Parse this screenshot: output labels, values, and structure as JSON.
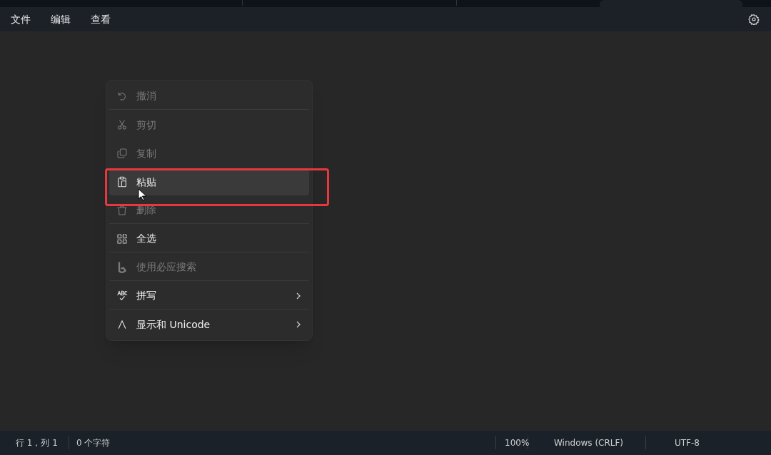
{
  "menu_bar": {
    "items": [
      "文件",
      "编辑",
      "查看"
    ]
  },
  "context_menu": {
    "items": [
      {
        "label": "撤消",
        "disabled": true,
        "hovered": false,
        "submenu": false,
        "separator_after": true
      },
      {
        "label": "剪切",
        "disabled": true,
        "hovered": false,
        "submenu": false,
        "separator_after": false
      },
      {
        "label": "复制",
        "disabled": true,
        "hovered": false,
        "submenu": false,
        "separator_after": false
      },
      {
        "label": "粘贴",
        "disabled": false,
        "hovered": true,
        "submenu": false,
        "separator_after": false
      },
      {
        "label": "删除",
        "disabled": true,
        "hovered": false,
        "submenu": false,
        "separator_after": true
      },
      {
        "label": "全选",
        "disabled": false,
        "hovered": false,
        "submenu": false,
        "separator_after": true
      },
      {
        "label": "使用必应搜索",
        "disabled": true,
        "hovered": false,
        "submenu": false,
        "separator_after": true
      },
      {
        "label": "拼写",
        "disabled": false,
        "hovered": false,
        "submenu": true,
        "separator_after": true
      },
      {
        "label": "显示和 Unicode",
        "disabled": false,
        "hovered": false,
        "submenu": true,
        "separator_after": false
      }
    ]
  },
  "status_bar": {
    "position": "行 1，列 1",
    "characters": "0 个字符",
    "zoom": "100%",
    "line_ending": "Windows (CRLF)",
    "encoding": "UTF-8"
  }
}
